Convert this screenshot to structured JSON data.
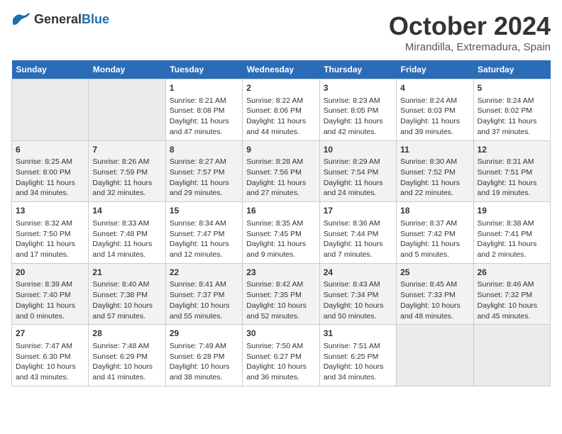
{
  "header": {
    "logo_general": "General",
    "logo_blue": "Blue",
    "month_title": "October 2024",
    "location": "Mirandilla, Extremadura, Spain"
  },
  "columns": [
    "Sunday",
    "Monday",
    "Tuesday",
    "Wednesday",
    "Thursday",
    "Friday",
    "Saturday"
  ],
  "weeks": [
    [
      {
        "day": "",
        "empty": true
      },
      {
        "day": "",
        "empty": true
      },
      {
        "day": "1",
        "sunrise": "Sunrise: 8:21 AM",
        "sunset": "Sunset: 8:08 PM",
        "daylight": "Daylight: 11 hours and 47 minutes."
      },
      {
        "day": "2",
        "sunrise": "Sunrise: 8:22 AM",
        "sunset": "Sunset: 8:06 PM",
        "daylight": "Daylight: 11 hours and 44 minutes."
      },
      {
        "day": "3",
        "sunrise": "Sunrise: 8:23 AM",
        "sunset": "Sunset: 8:05 PM",
        "daylight": "Daylight: 11 hours and 42 minutes."
      },
      {
        "day": "4",
        "sunrise": "Sunrise: 8:24 AM",
        "sunset": "Sunset: 8:03 PM",
        "daylight": "Daylight: 11 hours and 39 minutes."
      },
      {
        "day": "5",
        "sunrise": "Sunrise: 8:24 AM",
        "sunset": "Sunset: 8:02 PM",
        "daylight": "Daylight: 11 hours and 37 minutes."
      }
    ],
    [
      {
        "day": "6",
        "sunrise": "Sunrise: 8:25 AM",
        "sunset": "Sunset: 8:00 PM",
        "daylight": "Daylight: 11 hours and 34 minutes."
      },
      {
        "day": "7",
        "sunrise": "Sunrise: 8:26 AM",
        "sunset": "Sunset: 7:59 PM",
        "daylight": "Daylight: 11 hours and 32 minutes."
      },
      {
        "day": "8",
        "sunrise": "Sunrise: 8:27 AM",
        "sunset": "Sunset: 7:57 PM",
        "daylight": "Daylight: 11 hours and 29 minutes."
      },
      {
        "day": "9",
        "sunrise": "Sunrise: 8:28 AM",
        "sunset": "Sunset: 7:56 PM",
        "daylight": "Daylight: 11 hours and 27 minutes."
      },
      {
        "day": "10",
        "sunrise": "Sunrise: 8:29 AM",
        "sunset": "Sunset: 7:54 PM",
        "daylight": "Daylight: 11 hours and 24 minutes."
      },
      {
        "day": "11",
        "sunrise": "Sunrise: 8:30 AM",
        "sunset": "Sunset: 7:52 PM",
        "daylight": "Daylight: 11 hours and 22 minutes."
      },
      {
        "day": "12",
        "sunrise": "Sunrise: 8:31 AM",
        "sunset": "Sunset: 7:51 PM",
        "daylight": "Daylight: 11 hours and 19 minutes."
      }
    ],
    [
      {
        "day": "13",
        "sunrise": "Sunrise: 8:32 AM",
        "sunset": "Sunset: 7:50 PM",
        "daylight": "Daylight: 11 hours and 17 minutes."
      },
      {
        "day": "14",
        "sunrise": "Sunrise: 8:33 AM",
        "sunset": "Sunset: 7:48 PM",
        "daylight": "Daylight: 11 hours and 14 minutes."
      },
      {
        "day": "15",
        "sunrise": "Sunrise: 8:34 AM",
        "sunset": "Sunset: 7:47 PM",
        "daylight": "Daylight: 11 hours and 12 minutes."
      },
      {
        "day": "16",
        "sunrise": "Sunrise: 8:35 AM",
        "sunset": "Sunset: 7:45 PM",
        "daylight": "Daylight: 11 hours and 9 minutes."
      },
      {
        "day": "17",
        "sunrise": "Sunrise: 8:36 AM",
        "sunset": "Sunset: 7:44 PM",
        "daylight": "Daylight: 11 hours and 7 minutes."
      },
      {
        "day": "18",
        "sunrise": "Sunrise: 8:37 AM",
        "sunset": "Sunset: 7:42 PM",
        "daylight": "Daylight: 11 hours and 5 minutes."
      },
      {
        "day": "19",
        "sunrise": "Sunrise: 8:38 AM",
        "sunset": "Sunset: 7:41 PM",
        "daylight": "Daylight: 11 hours and 2 minutes."
      }
    ],
    [
      {
        "day": "20",
        "sunrise": "Sunrise: 8:39 AM",
        "sunset": "Sunset: 7:40 PM",
        "daylight": "Daylight: 11 hours and 0 minutes."
      },
      {
        "day": "21",
        "sunrise": "Sunrise: 8:40 AM",
        "sunset": "Sunset: 7:38 PM",
        "daylight": "Daylight: 10 hours and 57 minutes."
      },
      {
        "day": "22",
        "sunrise": "Sunrise: 8:41 AM",
        "sunset": "Sunset: 7:37 PM",
        "daylight": "Daylight: 10 hours and 55 minutes."
      },
      {
        "day": "23",
        "sunrise": "Sunrise: 8:42 AM",
        "sunset": "Sunset: 7:35 PM",
        "daylight": "Daylight: 10 hours and 52 minutes."
      },
      {
        "day": "24",
        "sunrise": "Sunrise: 8:43 AM",
        "sunset": "Sunset: 7:34 PM",
        "daylight": "Daylight: 10 hours and 50 minutes."
      },
      {
        "day": "25",
        "sunrise": "Sunrise: 8:45 AM",
        "sunset": "Sunset: 7:33 PM",
        "daylight": "Daylight: 10 hours and 48 minutes."
      },
      {
        "day": "26",
        "sunrise": "Sunrise: 8:46 AM",
        "sunset": "Sunset: 7:32 PM",
        "daylight": "Daylight: 10 hours and 45 minutes."
      }
    ],
    [
      {
        "day": "27",
        "sunrise": "Sunrise: 7:47 AM",
        "sunset": "Sunset: 6:30 PM",
        "daylight": "Daylight: 10 hours and 43 minutes."
      },
      {
        "day": "28",
        "sunrise": "Sunrise: 7:48 AM",
        "sunset": "Sunset: 6:29 PM",
        "daylight": "Daylight: 10 hours and 41 minutes."
      },
      {
        "day": "29",
        "sunrise": "Sunrise: 7:49 AM",
        "sunset": "Sunset: 6:28 PM",
        "daylight": "Daylight: 10 hours and 38 minutes."
      },
      {
        "day": "30",
        "sunrise": "Sunrise: 7:50 AM",
        "sunset": "Sunset: 6:27 PM",
        "daylight": "Daylight: 10 hours and 36 minutes."
      },
      {
        "day": "31",
        "sunrise": "Sunrise: 7:51 AM",
        "sunset": "Sunset: 6:25 PM",
        "daylight": "Daylight: 10 hours and 34 minutes."
      },
      {
        "day": "",
        "empty": true
      },
      {
        "day": "",
        "empty": true
      }
    ]
  ]
}
